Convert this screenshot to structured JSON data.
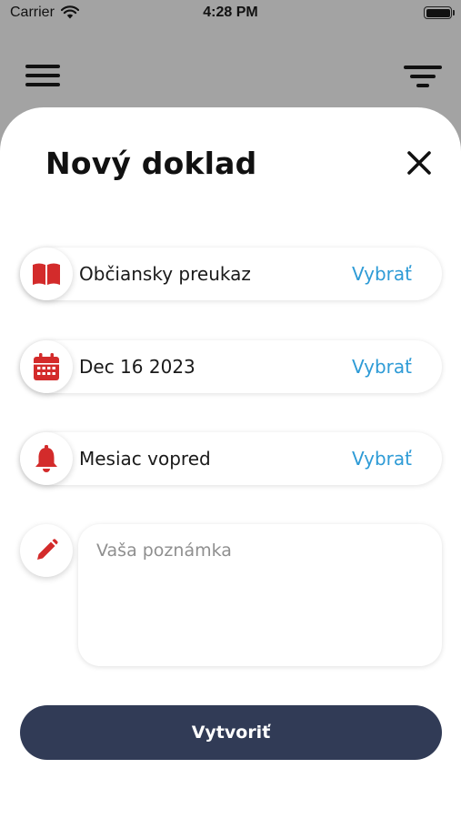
{
  "status_bar": {
    "carrier": "Carrier",
    "time": "4:28 PM"
  },
  "sheet": {
    "title": "Nový doklad",
    "rows": [
      {
        "icon": "book-icon",
        "label": "Občiansky preukaz",
        "action": "Vybrať"
      },
      {
        "icon": "calendar-icon",
        "label": "Dec 16 2023",
        "action": "Vybrať"
      },
      {
        "icon": "bell-icon",
        "label": "Mesiac vopred",
        "action": "Vybrať"
      }
    ],
    "note": {
      "icon": "pencil-icon",
      "placeholder": "Vaša poznámka",
      "value": ""
    },
    "create_label": "Vytvoriť"
  },
  "colors": {
    "accent": "#2e9bd6",
    "icon_red": "#d32b2b",
    "button_bg": "#313b56",
    "backdrop": "#a3a3a3"
  }
}
